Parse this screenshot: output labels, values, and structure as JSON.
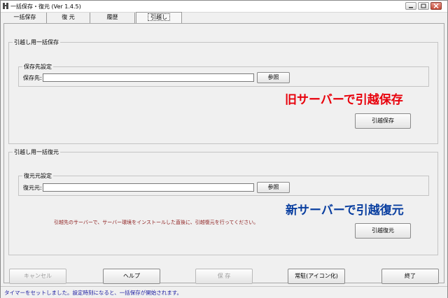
{
  "window": {
    "title": "一括保存・復元 (Ver 1.4.5)",
    "icon": "app-icon"
  },
  "tabs": [
    {
      "label": "一括保存"
    },
    {
      "label": "復 元"
    },
    {
      "label": "履歴"
    },
    {
      "label": "引越し"
    }
  ],
  "active_tab": 3,
  "save_section": {
    "group_title": "引越し用一括保存",
    "sub_group_title": "保存先設定",
    "field_label": "保存先:",
    "field_value": "",
    "browse_label": "参照",
    "caption": "旧サーバーで引越保存",
    "caption_color": "#e8000b",
    "action_label": "引越保存"
  },
  "restore_section": {
    "group_title": "引越し用一括復元",
    "sub_group_title": "復元元設定",
    "field_label": "復元元:",
    "field_value": "",
    "browse_label": "参照",
    "caption": "新サーバーで引越復元",
    "caption_color": "#0a3fa0",
    "note": "引越先のサーバーで、サーバー環境をインストールした直後に、引越復元を行ってください。",
    "action_label": "引越復元"
  },
  "bottom_buttons": {
    "cancel": "キャンセル",
    "help": "ヘルプ",
    "save": "保 存",
    "resident": "常駐(アイコン化)",
    "exit": "終了"
  },
  "status": "タイマーをセットしました。設定時刻になると、一括保存が開始されます。"
}
